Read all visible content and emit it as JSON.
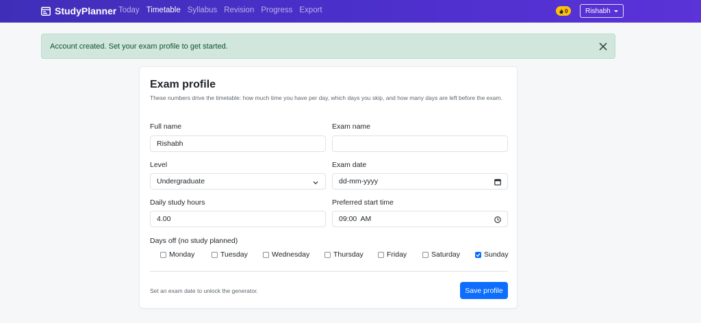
{
  "brand": {
    "name": "StudyPlanner"
  },
  "nav": {
    "links": [
      {
        "label": "Today",
        "active": false
      },
      {
        "label": "Timetable",
        "active": true
      },
      {
        "label": "Syllabus",
        "active": false
      },
      {
        "label": "Revision",
        "active": false
      },
      {
        "label": "Progress",
        "active": false
      },
      {
        "label": "Export",
        "active": false
      }
    ],
    "streak": {
      "icon": "fire-icon",
      "count": "0"
    },
    "user": {
      "label": "Rishabh"
    }
  },
  "alert": {
    "message": "Account created. Set your exam profile to get started."
  },
  "form": {
    "title": "Exam profile",
    "subtitle": "These numbers drive the timetable: how much time you have per day, which days you skip, and how many days are left before the exam.",
    "full_name": {
      "label": "Full name",
      "value": "Rishabh"
    },
    "exam_name": {
      "label": "Exam name",
      "value": ""
    },
    "level": {
      "label": "Level",
      "value": "Undergraduate"
    },
    "exam_date": {
      "label": "Exam date",
      "placeholder": "dd-mm-yyyy"
    },
    "daily_hours": {
      "label": "Daily study hours",
      "value": "4.00"
    },
    "start_time": {
      "label": "Preferred start time",
      "value": "09:00  AM"
    },
    "days_off": {
      "label": "Days off (no study planned)",
      "days": [
        {
          "label": "Monday",
          "checked": false
        },
        {
          "label": "Tuesday",
          "checked": false
        },
        {
          "label": "Wednesday",
          "checked": false
        },
        {
          "label": "Thursday",
          "checked": false
        },
        {
          "label": "Friday",
          "checked": false
        },
        {
          "label": "Saturday",
          "checked": false
        },
        {
          "label": "Sunday",
          "checked": true
        }
      ]
    },
    "hint": "Set an exam date to unlock the generator.",
    "save_label": "Save profile"
  },
  "colors": {
    "navbar": "#4a2fc9",
    "primary": "#0d6efd",
    "alert_bg": "#d1e7dd",
    "alert_text": "#0f5132",
    "streak": "#ffc107"
  }
}
